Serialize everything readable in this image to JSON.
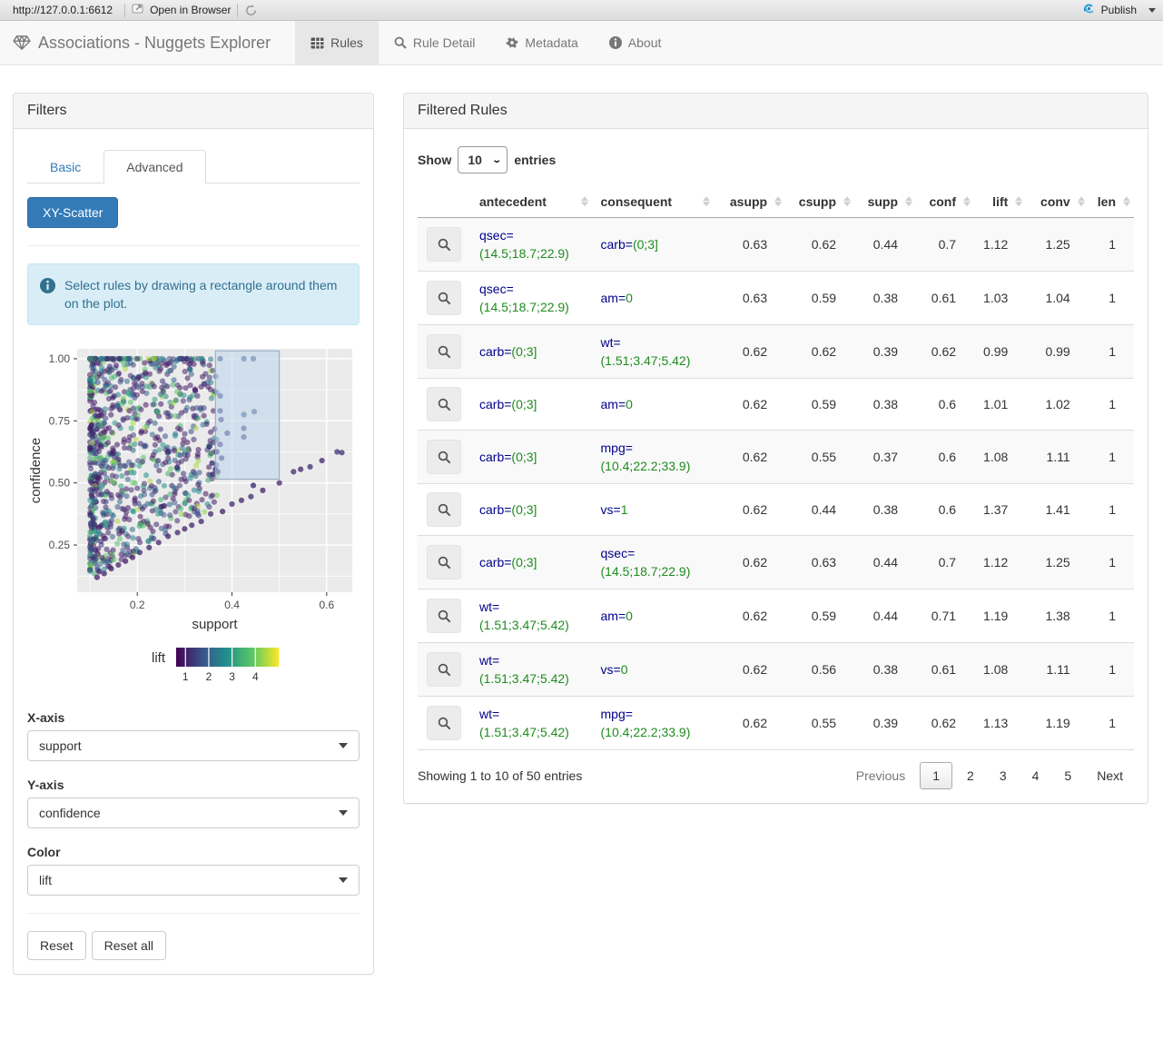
{
  "toolbar": {
    "url": "http://127.0.0.1:6612",
    "open_in_browser": "Open in Browser",
    "publish": "Publish"
  },
  "navbar": {
    "brand": "Associations - Nuggets Explorer",
    "tabs": [
      {
        "label": "Rules",
        "icon": "table-icon",
        "active": true
      },
      {
        "label": "Rule Detail",
        "icon": "search-icon",
        "active": false
      },
      {
        "label": "Metadata",
        "icon": "gear-icon",
        "active": false
      },
      {
        "label": "About",
        "icon": "info-icon",
        "active": false
      }
    ]
  },
  "filters": {
    "title": "Filters",
    "tab_basic": "Basic",
    "tab_advanced": "Advanced",
    "scatter_button": "XY-Scatter",
    "info_text": "Select rules by drawing a rectangle around them on the plot.",
    "xaxis_label": "X-axis",
    "xaxis_value": "support",
    "yaxis_label": "Y-axis",
    "yaxis_value": "confidence",
    "color_label": "Color",
    "color_value": "lift",
    "reset_label": "Reset",
    "reset_all_label": "Reset all"
  },
  "chart_data": {
    "type": "scatter",
    "xlabel": "support",
    "ylabel": "confidence",
    "xlim": [
      0.073,
      0.654
    ],
    "ylim": [
      0.06,
      1.04
    ],
    "xticks": [
      "0.2",
      "0.4",
      "0.6"
    ],
    "xtick_vals": [
      0.2,
      0.4,
      0.6
    ],
    "yticks": [
      "0.25",
      "0.50",
      "0.75",
      "1.00"
    ],
    "ytick_vals": [
      0.25,
      0.5,
      0.75,
      1.0
    ],
    "x_minor": [
      0.1,
      0.3,
      0.5
    ],
    "y_minor": [
      0.125,
      0.375,
      0.625,
      0.875
    ],
    "panel_bg": "#ebebeb",
    "grid_color": "#ffffff",
    "point_radius": 3.1,
    "point_opacity": 0.55,
    "selection_rect": {
      "x": [
        0.365,
        0.5
      ],
      "y": [
        0.515,
        1.032
      ],
      "fill": "rgba(188,212,235,0.55)",
      "stroke": "#8fa6bf"
    },
    "color_legend": {
      "label": "lift",
      "ticks": [
        "1",
        "2",
        "3",
        "4"
      ],
      "tick_vals": [
        1,
        2,
        3,
        4
      ],
      "domain": [
        0.6,
        5.0
      ],
      "palette": [
        "#440154",
        "#3b528b",
        "#21918c",
        "#5ec962",
        "#fde725"
      ]
    },
    "cloud": {
      "seed": 987654321,
      "n": 920,
      "x_min": 0.1,
      "x_span": 0.27,
      "y_floor": 0.125,
      "top_row_n": 72,
      "lift_min": 0.85,
      "lift_span": 3.7
    },
    "diag_points": [
      [
        0.115,
        0.12,
        1.0
      ],
      [
        0.13,
        0.135,
        1.05
      ],
      [
        0.145,
        0.155,
        1.0
      ],
      [
        0.16,
        0.17,
        1.1
      ],
      [
        0.175,
        0.185,
        1.0
      ],
      [
        0.19,
        0.2,
        1.05
      ],
      [
        0.205,
        0.22,
        1.1
      ],
      [
        0.225,
        0.24,
        1.0
      ],
      [
        0.245,
        0.26,
        1.1
      ],
      [
        0.265,
        0.285,
        1.05
      ],
      [
        0.285,
        0.3,
        1.1
      ],
      [
        0.3,
        0.315,
        1.0
      ],
      [
        0.315,
        0.33,
        1.1
      ],
      [
        0.335,
        0.345,
        1.05
      ],
      [
        0.355,
        0.375,
        1.1
      ],
      [
        0.38,
        0.385,
        1.0
      ],
      [
        0.4,
        0.415,
        1.1
      ],
      [
        0.42,
        0.43,
        1.05
      ],
      [
        0.44,
        0.445,
        1.15
      ],
      [
        0.465,
        0.47,
        1.05
      ],
      [
        0.5,
        0.5,
        1.1
      ],
      [
        0.53,
        0.545,
        1.15
      ],
      [
        0.545,
        0.555,
        1.1
      ],
      [
        0.565,
        0.565,
        1.2
      ],
      [
        0.59,
        0.59,
        1.1
      ],
      [
        0.622,
        0.625,
        1.25
      ],
      [
        0.632,
        0.622,
        1.2
      ]
    ],
    "rect_points": [
      [
        0.375,
        1.0,
        1.6
      ],
      [
        0.425,
        1.0,
        1.9
      ],
      [
        0.445,
        1.0,
        1.8
      ],
      [
        0.375,
        0.85,
        1.5
      ],
      [
        0.375,
        0.79,
        1.45
      ],
      [
        0.377,
        0.755,
        1.4
      ],
      [
        0.425,
        0.775,
        1.9
      ],
      [
        0.447,
        0.787,
        1.9
      ],
      [
        0.425,
        0.72,
        1.5
      ],
      [
        0.425,
        0.685,
        1.6
      ],
      [
        0.39,
        0.7,
        1.35
      ],
      [
        0.375,
        0.655,
        1.3
      ],
      [
        0.368,
        0.625,
        1.25
      ],
      [
        0.378,
        0.6,
        1.3
      ],
      [
        0.445,
        0.49,
        1.2
      ],
      [
        0.352,
        0.645,
        1.3
      ],
      [
        0.358,
        0.58,
        1.25
      ],
      [
        0.365,
        0.555,
        1.2
      ],
      [
        0.37,
        0.545,
        1.25
      ],
      [
        0.36,
        0.535,
        1.2
      ]
    ]
  },
  "rules_panel": {
    "title": "Filtered Rules",
    "show_label": "Show",
    "page_length": "10",
    "entries_label": "entries",
    "columns": [
      "antecedent",
      "consequent",
      "asupp",
      "csupp",
      "supp",
      "conf",
      "lift",
      "conv",
      "len"
    ],
    "rows": [
      {
        "antecedent": {
          "attr": "qsec",
          "value": "(14.5;18.7;22.9)"
        },
        "consequent": {
          "attr": "carb",
          "value": "(0;3]"
        },
        "asupp": "0.63",
        "csupp": "0.62",
        "supp": "0.44",
        "conf": "0.7",
        "lift": "1.12",
        "conv": "1.25",
        "len": "1"
      },
      {
        "antecedent": {
          "attr": "qsec",
          "value": "(14.5;18.7;22.9)"
        },
        "consequent": {
          "attr": "am",
          "value": "0"
        },
        "asupp": "0.63",
        "csupp": "0.59",
        "supp": "0.38",
        "conf": "0.61",
        "lift": "1.03",
        "conv": "1.04",
        "len": "1"
      },
      {
        "antecedent": {
          "attr": "carb",
          "value": "(0;3]"
        },
        "consequent": {
          "attr": "wt",
          "value": "(1.51;3.47;5.42)"
        },
        "asupp": "0.62",
        "csupp": "0.62",
        "supp": "0.39",
        "conf": "0.62",
        "lift": "0.99",
        "conv": "0.99",
        "len": "1"
      },
      {
        "antecedent": {
          "attr": "carb",
          "value": "(0;3]"
        },
        "consequent": {
          "attr": "am",
          "value": "0"
        },
        "asupp": "0.62",
        "csupp": "0.59",
        "supp": "0.38",
        "conf": "0.6",
        "lift": "1.01",
        "conv": "1.02",
        "len": "1"
      },
      {
        "antecedent": {
          "attr": "carb",
          "value": "(0;3]"
        },
        "consequent": {
          "attr": "mpg",
          "value": "(10.4;22.2;33.9)"
        },
        "asupp": "0.62",
        "csupp": "0.55",
        "supp": "0.37",
        "conf": "0.6",
        "lift": "1.08",
        "conv": "1.11",
        "len": "1"
      },
      {
        "antecedent": {
          "attr": "carb",
          "value": "(0;3]"
        },
        "consequent": {
          "attr": "vs",
          "value": "1"
        },
        "asupp": "0.62",
        "csupp": "0.44",
        "supp": "0.38",
        "conf": "0.6",
        "lift": "1.37",
        "conv": "1.41",
        "len": "1"
      },
      {
        "antecedent": {
          "attr": "carb",
          "value": "(0;3]"
        },
        "consequent": {
          "attr": "qsec",
          "value": "(14.5;18.7;22.9)"
        },
        "asupp": "0.62",
        "csupp": "0.63",
        "supp": "0.44",
        "conf": "0.7",
        "lift": "1.12",
        "conv": "1.25",
        "len": "1"
      },
      {
        "antecedent": {
          "attr": "wt",
          "value": "(1.51;3.47;5.42)"
        },
        "consequent": {
          "attr": "am",
          "value": "0"
        },
        "asupp": "0.62",
        "csupp": "0.59",
        "supp": "0.44",
        "conf": "0.71",
        "lift": "1.19",
        "conv": "1.38",
        "len": "1"
      },
      {
        "antecedent": {
          "attr": "wt",
          "value": "(1.51;3.47;5.42)"
        },
        "consequent": {
          "attr": "vs",
          "value": "0"
        },
        "asupp": "0.62",
        "csupp": "0.56",
        "supp": "0.38",
        "conf": "0.61",
        "lift": "1.08",
        "conv": "1.11",
        "len": "1"
      },
      {
        "antecedent": {
          "attr": "wt",
          "value": "(1.51;3.47;5.42)"
        },
        "consequent": {
          "attr": "mpg",
          "value": "(10.4;22.2;33.9)"
        },
        "asupp": "0.62",
        "csupp": "0.55",
        "supp": "0.39",
        "conf": "0.62",
        "lift": "1.13",
        "conv": "1.19",
        "len": "1"
      }
    ],
    "footer_info": "Showing 1 to 10 of 50 entries",
    "pagination": {
      "previous": "Previous",
      "pages": [
        "1",
        "2",
        "3",
        "4",
        "5"
      ],
      "current": "1",
      "next": "Next"
    }
  },
  "colors": {
    "accent": "#337ab7",
    "rule_attr": "#00008b",
    "rule_value": "#1e8c1e",
    "publish_blue": "#2196d6"
  }
}
